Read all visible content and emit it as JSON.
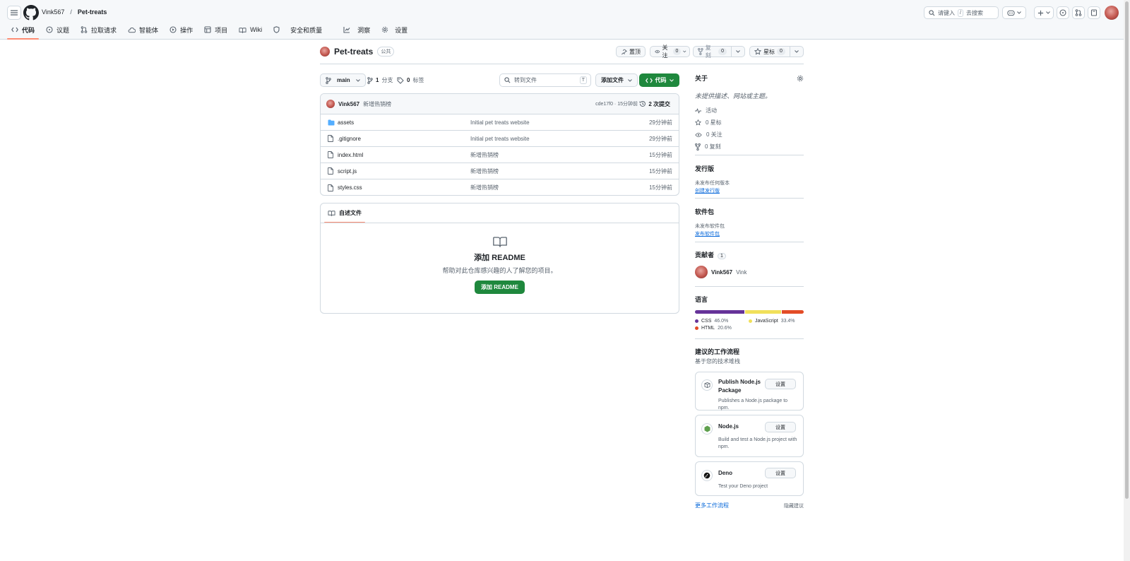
{
  "header": {
    "owner": "Vink567",
    "separator": "/",
    "repo": "Pet-treats",
    "search_placeholder": "请键入",
    "search_key": "/",
    "search_suffix": "去搜索"
  },
  "tabs": [
    {
      "label": "代码",
      "icon": "code-icon",
      "selected": true
    },
    {
      "label": "议题",
      "icon": "issue-icon"
    },
    {
      "label": "拉取请求",
      "icon": "pull-request-icon"
    },
    {
      "label": "智能体",
      "icon": "agent-icon"
    },
    {
      "label": "操作",
      "icon": "play-icon"
    },
    {
      "label": "项目",
      "icon": "table-icon"
    },
    {
      "label": "Wiki",
      "icon": "book-icon"
    },
    {
      "label": "安全和质量",
      "icon": "shield-icon"
    },
    {
      "label": "洞察",
      "icon": "graph-icon"
    },
    {
      "label": "设置",
      "icon": "gear-icon"
    }
  ],
  "repo": {
    "name": "Pet-treats",
    "visibility": "公共",
    "pin_label": "置顶",
    "watch_label": "关注",
    "watch_count": "0",
    "fork_label": "复刻",
    "fork_count": "0",
    "star_label": "星标",
    "star_count": "0"
  },
  "toolbar": {
    "branch": "main",
    "branches_count": "1",
    "branches_label": "分支",
    "tags_count": "0",
    "tags_label": "标签",
    "file_search_placeholder": "转到文件",
    "file_search_key": "T",
    "add_file_label": "添加文件",
    "code_label": "代码"
  },
  "commit": {
    "author": "Vink567",
    "message": "新增热销榜",
    "hash_time": "cde17f0 · 15分钟前",
    "history": "2 次提交"
  },
  "files": [
    {
      "name": "assets",
      "type": "folder",
      "message": "Initial pet treats website",
      "age": "29分钟前"
    },
    {
      "name": ".gitignore",
      "type": "file",
      "message": "Initial pet treats website",
      "age": "29分钟前"
    },
    {
      "name": "index.html",
      "type": "file",
      "message": "新增热销榜",
      "age": "15分钟前"
    },
    {
      "name": "script.js",
      "type": "file",
      "message": "新增热销榜",
      "age": "15分钟前"
    },
    {
      "name": "styles.css",
      "type": "file",
      "message": "新增热销榜",
      "age": "15分钟前"
    }
  ],
  "readme": {
    "tab_label": "自述文件",
    "title": "添加 README",
    "subtitle": "帮助对此仓库感兴趣的人了解您的项目。",
    "button": "添加 README"
  },
  "about": {
    "title": "关于",
    "description": "未提供描述、网站或主题。",
    "activity": "活动",
    "stars": "0 星标",
    "watchers": "0 关注",
    "forks": "0 复刻"
  },
  "releases": {
    "title": "发行版",
    "none": "未发布任何版本",
    "create": "创建发行版"
  },
  "packages": {
    "title": "软件包",
    "none": "未发布软件包",
    "publish": "发布软件包"
  },
  "contributors": {
    "title": "贡献者",
    "count": "1",
    "login": "Vink567",
    "name": "Vink"
  },
  "languages": {
    "title": "语言",
    "items": [
      {
        "name": "CSS",
        "pct": "46.0%",
        "value": 46.0,
        "color": "#663399"
      },
      {
        "name": "JavaScript",
        "pct": "33.4%",
        "value": 33.4,
        "color": "#f1e05a"
      },
      {
        "name": "HTML",
        "pct": "20.6%",
        "value": 20.6,
        "color": "#e34c26"
      }
    ]
  },
  "workflows": {
    "title": "建议的工作流程",
    "subtitle": "基于您的技术堆栈",
    "items": [
      {
        "name": "Publish Node.js Package",
        "desc": "Publishes a Node.js package to npm.",
        "button": "设置",
        "icon": "package-icon"
      },
      {
        "name": "Node.js",
        "desc": "Build and test a Node.js project with npm.",
        "button": "设置",
        "icon": "nodejs-icon"
      },
      {
        "name": "Deno",
        "desc": "Test your Deno project",
        "button": "设置",
        "icon": "deno-icon"
      }
    ],
    "more": "更多工作流程",
    "hide": "隐藏建议"
  },
  "colors": {
    "accent": "#1f883d",
    "link": "#0969da",
    "tab_underline": "#fd8c73",
    "folder": "#54aeff"
  }
}
